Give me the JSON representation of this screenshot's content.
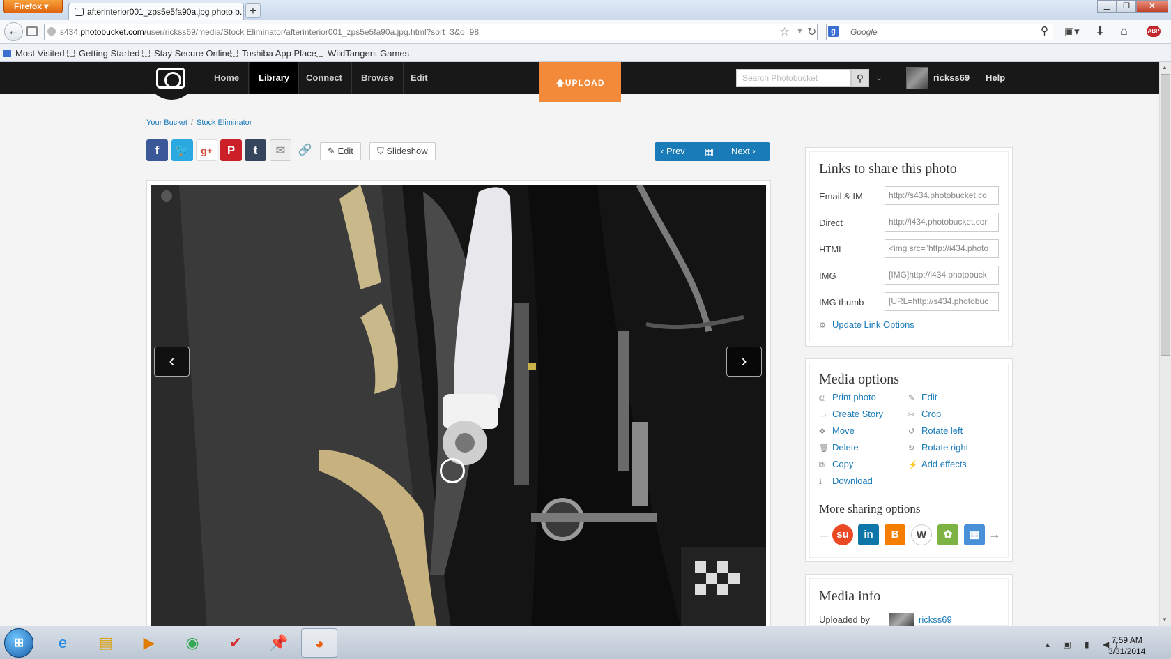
{
  "browser": {
    "firefox_button": "Firefox",
    "tab_title": "afterinterior001_zps5e5fa90a.jpg photo b...",
    "new_tab": "+",
    "url_prefix": "s434.",
    "url_domain": "photobucket.com",
    "url_path": "/user/rickss69/media/Stock Eliminator/afterinterior001_zps5e5fa90a.jpg.html?sort=3&o=98",
    "search_placeholder": "Google",
    "bookmarks": [
      "Most Visited",
      "Getting Started",
      "Stay Secure Online",
      "Toshiba App Place",
      "WildTangent Games"
    ]
  },
  "header": {
    "nav": [
      "Home",
      "Library",
      "Connect",
      "Browse",
      "Edit"
    ],
    "upload_label": "UPLOAD",
    "search_placeholder": "Search Photobucket",
    "username": "rickss69",
    "help": "Help"
  },
  "breadcrumb": [
    "Your Bucket",
    "Stock Eliminator"
  ],
  "toolbar": {
    "edit_label": "Edit",
    "slideshow_label": "Slideshow",
    "prev_label": "Prev",
    "next_label": "Next"
  },
  "share_links": {
    "title": "Links to share this photo",
    "rows": [
      {
        "label": "Email & IM",
        "value": "http://s434.photobucket.co"
      },
      {
        "label": "Direct",
        "value": "http://i434.photobucket.cor"
      },
      {
        "label": "HTML",
        "value": "<img src=\"http://i434.photo"
      },
      {
        "label": "IMG",
        "value": "[IMG]http://i434.photobuck"
      },
      {
        "label": "IMG thumb",
        "value": "[URL=http://s434.photobuc"
      }
    ],
    "update_link": "Update Link Options"
  },
  "media_options": {
    "title": "Media options",
    "left": [
      "Print photo",
      "Create Story",
      "Move",
      "Delete",
      "Copy",
      "Download"
    ],
    "right": [
      "Edit",
      "Crop",
      "Rotate left",
      "Rotate right",
      "Add effects"
    ],
    "more_title": "More sharing options"
  },
  "media_info": {
    "title": "Media info",
    "uploaded_by_label": "Uploaded by",
    "uploader": "rickss69"
  },
  "taskbar": {
    "time": "7:59 AM",
    "date": "3/31/2014"
  },
  "colors": {
    "link_blue": "#1a7bb9",
    "upload_orange": "#f38a3a",
    "header_black": "#181818"
  }
}
